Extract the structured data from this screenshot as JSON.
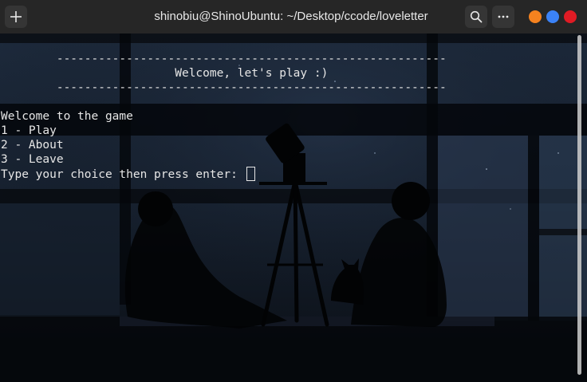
{
  "window": {
    "title": "shinobiu@ShinoUbuntu: ~/Desktop/ccode/loveletter",
    "new_tab_icon": "plus-icon",
    "search_icon": "search-icon",
    "menu_icon": "more-horizontal-icon",
    "controls": {
      "minimize_color": "#f5821f",
      "maximize_color": "#3b82f6",
      "close_color": "#e01b24"
    }
  },
  "terminal": {
    "banner_top": "        --------------------------------------------------------",
    "banner_title": "                         Welcome, let's play :)",
    "banner_bottom": "        --------------------------------------------------------",
    "blank": "",
    "welcome": "Welcome to the game",
    "option_play": "1 - Play",
    "option_about": "2 - About",
    "option_leave": "3 - Leave",
    "prompt": "Type your choice then press enter: "
  },
  "colors": {
    "titlebar": "#262626",
    "text": "#e6e6e6"
  }
}
